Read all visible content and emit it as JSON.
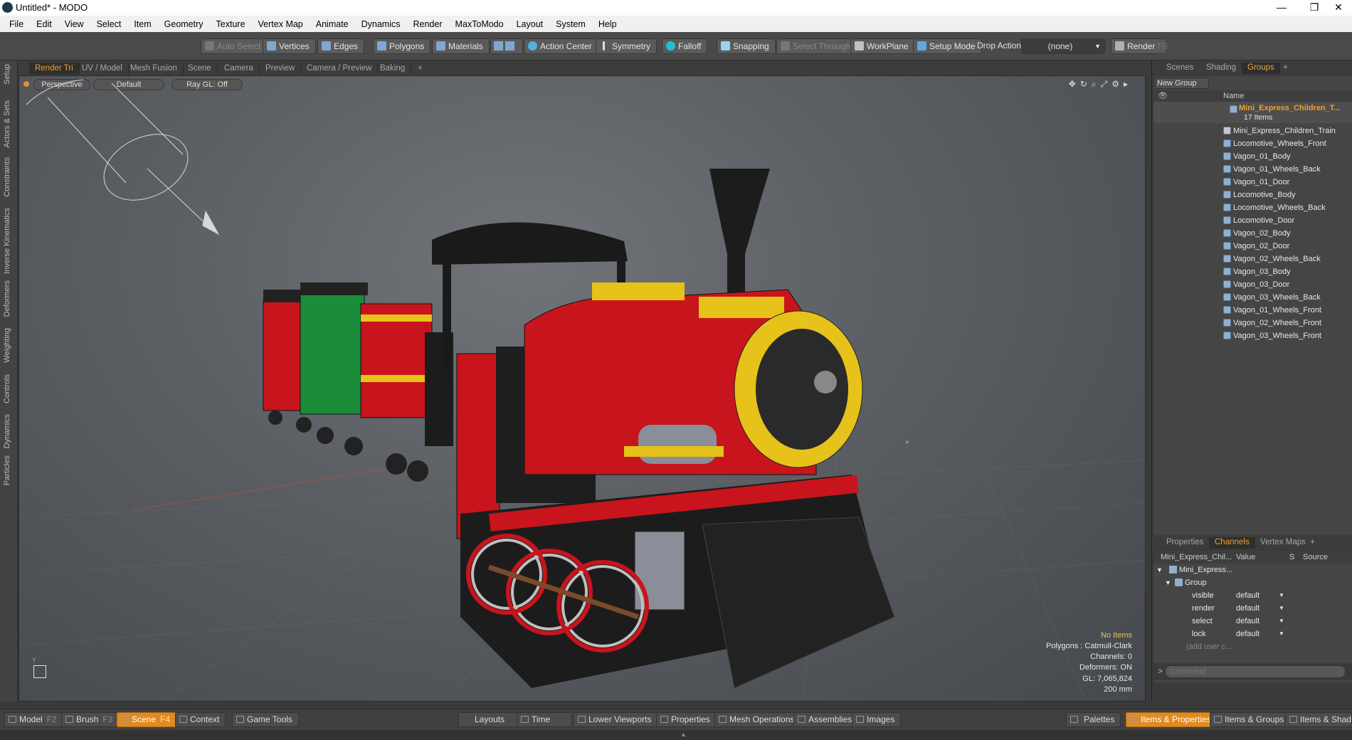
{
  "titlebar": {
    "title": "Untitled* - MODO",
    "min": "—",
    "max": "❐",
    "close": "✕"
  },
  "menu": [
    "File",
    "Edit",
    "View",
    "Select",
    "Item",
    "Geometry",
    "Texture",
    "Vertex Map",
    "Animate",
    "Dynamics",
    "Render",
    "MaxToModo",
    "Layout",
    "System",
    "Help"
  ],
  "toolbar": {
    "auto_select": "Auto Select",
    "vertices": "Vertices",
    "edges": "Edges",
    "polygons": "Polygons",
    "materials": "Materials",
    "action_center": "Action Center",
    "symmetry": "Symmetry",
    "falloff": "Falloff",
    "snapping": "Snapping",
    "select_through": "Select Through",
    "workplane": "WorkPlane",
    "setup_mode": "Setup Mode",
    "drop_action": "Drop Action",
    "drop_value": "(none)",
    "render": "Render",
    "render_key": "F9"
  },
  "left_tabs": [
    "Setup",
    "Actors & Sets",
    "Constraints",
    "Inverse Kinematics",
    "Deformers",
    "Weighting",
    "Controls",
    "Dynamics",
    "Particles"
  ],
  "viewport_tabs": [
    "Render Tri",
    "UV / Model",
    "Mesh Fusion",
    "Scene",
    "Camera",
    "Preview",
    "Camera / Preview",
    "Baking",
    "+"
  ],
  "viewport": {
    "view_mode": "Perspective",
    "shading": "Default",
    "raygl": "Ray GL: Off",
    "info": {
      "items": "No Items",
      "polygons": "Polygons : Catmull-Clark",
      "channels": "Channels: 0",
      "deformers": "Deformers: ON",
      "gl": "GL: 7,065,824",
      "scale": "200 mm"
    }
  },
  "right_tabs": [
    "Scenes",
    "Shading",
    "Groups",
    "+"
  ],
  "groups": {
    "new_group": "New Group",
    "col_name": "Name",
    "root": "Mini_Express_Children_T...",
    "count": "17 Items",
    "items": [
      "Mini_Express_Children_Train",
      "Locomotive_Wheels_Front",
      "Vagon_01_Body",
      "Vagon_01_Wheels_Back",
      "Vagon_01_Door",
      "Locomotive_Body",
      "Locomotive_Wheels_Back",
      "Locomotive_Door",
      "Vagon_02_Body",
      "Vagon_02_Door",
      "Vagon_02_Wheels_Back",
      "Vagon_03_Body",
      "Vagon_03_Door",
      "Vagon_03_Wheels_Back",
      "Vagon_01_Wheels_Front",
      "Vagon_02_Wheels_Front",
      "Vagon_03_Wheels_Front"
    ]
  },
  "lower_tabs": [
    "Properties",
    "Channels",
    "Vertex Maps",
    "+"
  ],
  "channels": {
    "col_item": "Mini_Express_Chil...",
    "col_value": "Value",
    "col_s": "S",
    "col_source": "Source",
    "root": "Mini_Express...",
    "group": "Group",
    "rows": [
      {
        "name": "visible",
        "value": "default"
      },
      {
        "name": "render",
        "value": "default"
      },
      {
        "name": "select",
        "value": "default"
      },
      {
        "name": "lock",
        "value": "default"
      }
    ],
    "add_user": "(add user c...",
    "command_placeholder": "Command"
  },
  "bottom": {
    "model": "Model",
    "model_key": "F2",
    "brush": "Brush",
    "brush_key": "F3",
    "scene": "Scene",
    "scene_key": "F4",
    "context": "Context",
    "game_tools": "Game Tools",
    "layouts": "Layouts",
    "time": "Time",
    "lower_viewports": "Lower Viewports",
    "properties": "Properties",
    "mesh_operations": "Mesh Operations",
    "assemblies": "Assemblies",
    "images": "Images",
    "palettes": "Palettes",
    "items_properties": "Items & Properties",
    "items_groups": "Items & Groups",
    "items_shading": "Items & Shadin"
  },
  "colors": {
    "accent": "#f0a030",
    "active_tab": "#e08a20",
    "train_red": "#c8141c",
    "train_yellow": "#e6c21a",
    "train_green": "#1a8c3a"
  }
}
